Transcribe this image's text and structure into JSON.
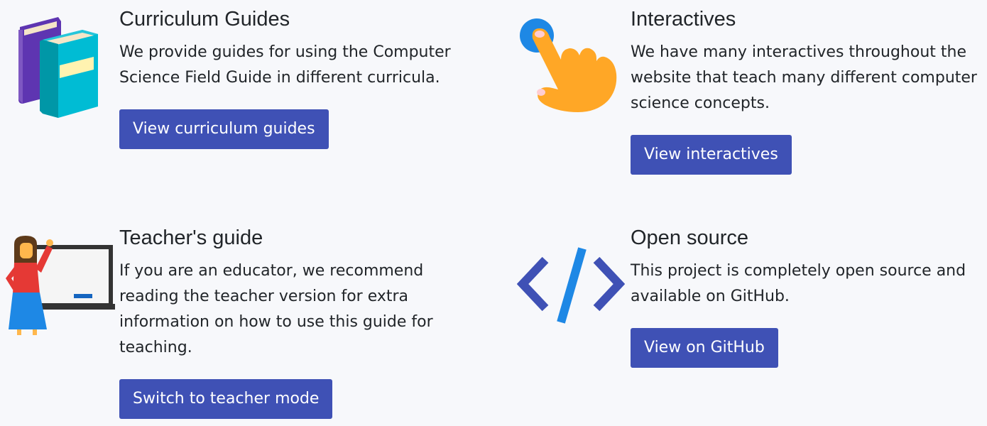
{
  "colors": {
    "background": "#f7f8fb",
    "button": "#3f51b5",
    "button_text": "#ffffff",
    "text": "#212529"
  },
  "cards": [
    {
      "icon": "books-icon",
      "title": "Curriculum Guides",
      "text": "We provide guides for using the Computer Science Field Guide in different curricula.",
      "button": "View curriculum guides"
    },
    {
      "icon": "pointing-hand-icon",
      "title": "Interactives",
      "text": "We have many interactives throughout the website that teach many different computer science concepts.",
      "button": "View interactives"
    },
    {
      "icon": "teacher-whiteboard-icon",
      "title": "Teacher's guide",
      "text": "If you are an educator, we recommend reading the teacher version for extra information on how to use this guide for teaching.",
      "button": "Switch to teacher mode"
    },
    {
      "icon": "code-brackets-icon",
      "title": "Open source",
      "text": "This project is completely open source and available on GitHub.",
      "button": "View on GitHub"
    }
  ]
}
